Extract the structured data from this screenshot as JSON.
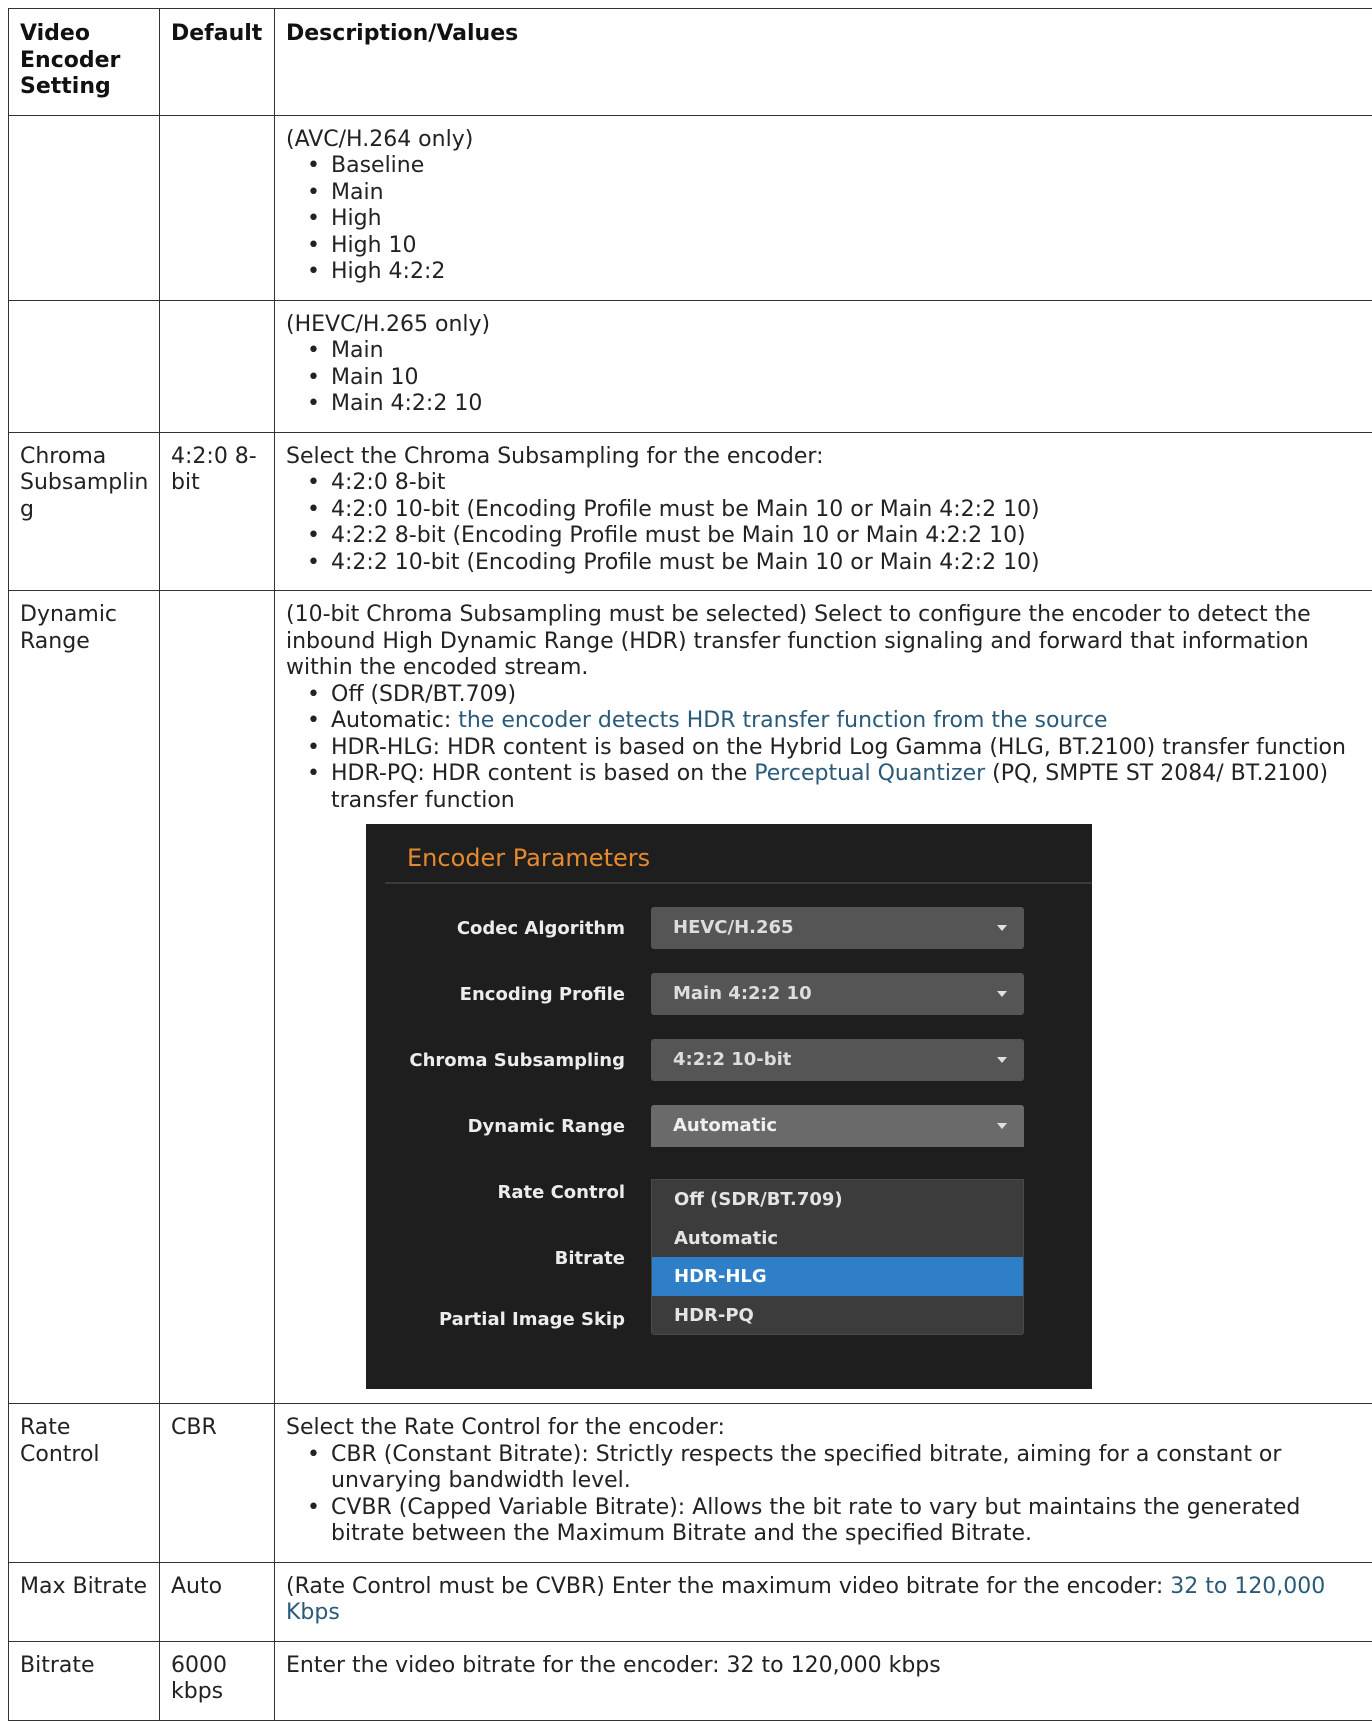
{
  "header": {
    "col1": "Video Encoder Setting",
    "col2": "Default",
    "col3": "Description/Values"
  },
  "rows": {
    "avc": {
      "setting": "",
      "default": "",
      "intro": "(AVC/H.264 only)",
      "options": [
        "Baseline",
        "Main",
        "High",
        "High 10",
        "High 4:2:2"
      ]
    },
    "hevc": {
      "setting": "",
      "default": "",
      "intro": "(HEVC/H.265 only)",
      "options": [
        "Main",
        "Main 10",
        "Main 4:2:2 10"
      ]
    },
    "chroma": {
      "setting": "Chroma Subsampling",
      "default": "4:2:0 8-bit",
      "intro": "Select the Chroma Subsampling for the encoder:",
      "options": [
        "4:2:0 8-bit",
        "4:2:0 10-bit (Encoding Profile must be Main 10 or Main 4:2:2 10)",
        "4:2:2 8-bit (Encoding Profile must be Main 10 or Main 4:2:2 10)",
        "4:2:2 10-bit (Encoding Profile must be Main 10 or Main 4:2:2 10)"
      ]
    },
    "dynamic": {
      "setting": "Dynamic Range",
      "default": "",
      "intro": "(10-bit Chroma Subsampling must be selected) Select to configure the encoder to detect the inbound High Dynamic Range (HDR) transfer function signaling and forward that information within the encoded stream.",
      "opt_off": "Off (SDR/BT.709)",
      "opt_auto_prefix": "Automatic: ",
      "opt_auto_link": "the encoder detects HDR transfer function from the source",
      "opt_hlg": "HDR-HLG: HDR content is based on the Hybrid Log Gamma (HLG, BT.2100) transfer function",
      "opt_pq_prefix": "HDR-PQ: HDR content is based on the ",
      "opt_pq_link": "Perceptual Quantizer",
      "opt_pq_suffix": " (PQ, SMPTE ST 2084/ BT.2100) transfer function"
    },
    "rate": {
      "setting": "Rate Control",
      "default": "CBR",
      "intro": "Select the Rate Control for the encoder:",
      "options": [
        "CBR (Constant Bitrate): Strictly respects the specified bitrate, aiming for a constant or unvarying bandwidth level.",
        "CVBR (Capped Variable Bitrate): Allows the bit rate to vary but maintains the generated bitrate between the Maximum Bitrate and the specified Bitrate."
      ]
    },
    "maxbitrate": {
      "setting": "Max Bitrate",
      "default": "Auto",
      "text": "(Rate Control must be CVBR) Enter the maximum video bitrate for the encoder: ",
      "link": "32 to 120,000 Kbps"
    },
    "bitrate": {
      "setting": "Bitrate",
      "default": "6000 kbps",
      "text": "Enter the video bitrate for the encoder: 32 to 120,000 kbps"
    }
  },
  "encoder_panel": {
    "title": "Encoder Parameters",
    "labels": {
      "codec": "Codec Algorithm",
      "profile": "Encoding Profile",
      "chroma": "Chroma Subsampling",
      "dynamic": "Dynamic Range",
      "rate": "Rate Control",
      "bitrate": "Bitrate",
      "skip": "Partial Image Skip"
    },
    "values": {
      "codec": "HEVC/H.265",
      "profile": "Main 4:2:2 10",
      "chroma": "4:2:2 10-bit",
      "dynamic": "Automatic"
    },
    "dynamic_menu": [
      "Off (SDR/BT.709)",
      "Automatic",
      "HDR-HLG",
      "HDR-PQ"
    ],
    "highlighted_option": "HDR-HLG",
    "partial_image_skip_checked": false,
    "colors": {
      "background": "#1e1e1e",
      "title": "#e58a2e",
      "highlight": "#2f7fc8"
    }
  }
}
